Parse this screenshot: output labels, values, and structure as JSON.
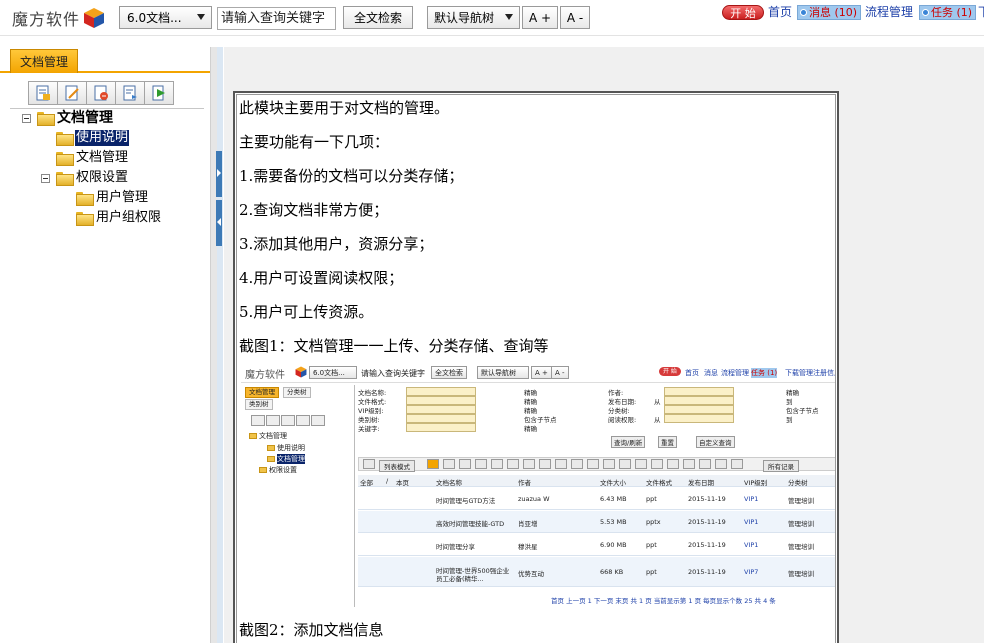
{
  "topbar": {
    "logo_text": "魔方软件",
    "version_select": "6.0文档...",
    "search_placeholder": "请输入查询关键字",
    "fulltext_button": "全文检索",
    "nav_select": "默认导航树",
    "font_increase": "A +",
    "font_decrease": "A -",
    "start_label": "开 始",
    "home_link": "首页",
    "messages_label": "消息 (10)",
    "workflow_link": "流程管理",
    "tasks_label": "任务 (1)",
    "truncated_link": "下"
  },
  "left_panel": {
    "tab_label": "文档管理",
    "toolbar_icons": [
      "add-doc-icon",
      "edit-doc-icon",
      "delete-doc-icon",
      "move-doc-icon",
      "export-doc-icon"
    ],
    "tree": {
      "root": "文档管理",
      "children": [
        "使用说明",
        "文档管理",
        "权限设置"
      ],
      "permission_children": [
        "用户管理",
        "用户组权限"
      ]
    },
    "selected_item": "使用说明"
  },
  "content": {
    "paragraphs": [
      "此模块主要用于对文档的管理。",
      "主要功能有一下几项：",
      "1.需要备份的文档可以分类存储；",
      "2.查询文档非常方便；",
      "3.添加其他用户，资源分享；",
      "4.用户可设置阅读权限；",
      "5.用户可上传资源。",
      "截图1：文档管理一一上传、分类存储、查询等"
    ],
    "caption2": "截图2：添加文档信息"
  },
  "screenshot": {
    "logo": "魔方软件",
    "version": "6.0文档...",
    "search": "请输入查询关键字",
    "fulltext": "全文检索",
    "nav": "默认导航树",
    "aplus": "A +",
    "aminus": "A -",
    "start": "开 始",
    "links": [
      "首页",
      "消息",
      "流程管理"
    ],
    "tasks": "任务 (1)",
    "links2": [
      "下载管理",
      "注册信息"
    ],
    "tabs": [
      "文档管理",
      "分类树",
      "类别树"
    ],
    "tree_root": "文档管理",
    "tree_items": [
      "使用说明",
      "文档管理",
      "权限设置"
    ],
    "form_left": [
      "文档名称:",
      "文件格式:",
      "VIP级别:",
      "类别树:",
      "关键字:"
    ],
    "form_mid": [
      "精确",
      "精确",
      "包含子节点",
      "精确",
      "精确"
    ],
    "form_right": [
      "作者:",
      "发布日期:",
      "分类树:",
      "阅读权限:"
    ],
    "form_from": [
      "从",
      "从"
    ],
    "form_far": [
      "精确",
      "到",
      "包含子节点",
      "到"
    ],
    "buttons": [
      "查询/刷新",
      "重置",
      "自定义查询"
    ],
    "list_mode": "列表模式",
    "all_records": "所有记录",
    "columns": [
      "全部",
      "/",
      "本页",
      "文档名称",
      "作者",
      "文件大小",
      "文件格式",
      "发布日期",
      "VIP级别",
      "分类树"
    ],
    "rows": [
      [
        "时间管理与GTD方法",
        "zuazua W",
        "6.43 MB",
        "ppt",
        "2015-11-19",
        "VIP1",
        "管理培训"
      ],
      [
        "高效时间管理技能-GTD",
        "肖亚增",
        "5.53 MB",
        "pptx",
        "2015-11-19",
        "VIP1",
        "管理培训"
      ],
      [
        "时间管理分享",
        "穆洪星",
        "6.90 MB",
        "ppt",
        "2015-11-19",
        "VIP1",
        "管理培训"
      ],
      [
        "时间管理-世界500强企业员工必备(精华...",
        "优势互动",
        "668 KB",
        "ppt",
        "2015-11-19",
        "VIP7",
        "管理培训"
      ]
    ],
    "pager": "首页  上一页  1  下一页  末页  共 1 页  当前显示第 1 页  每页显示个数 25  共 4 条"
  },
  "colors": {
    "tab_orange": "#f3a400",
    "link_blue": "#1c3fa8",
    "splitter_blue": "#3d7ab6",
    "selected_bg": "#0a246a",
    "start_red": "#d43030"
  }
}
